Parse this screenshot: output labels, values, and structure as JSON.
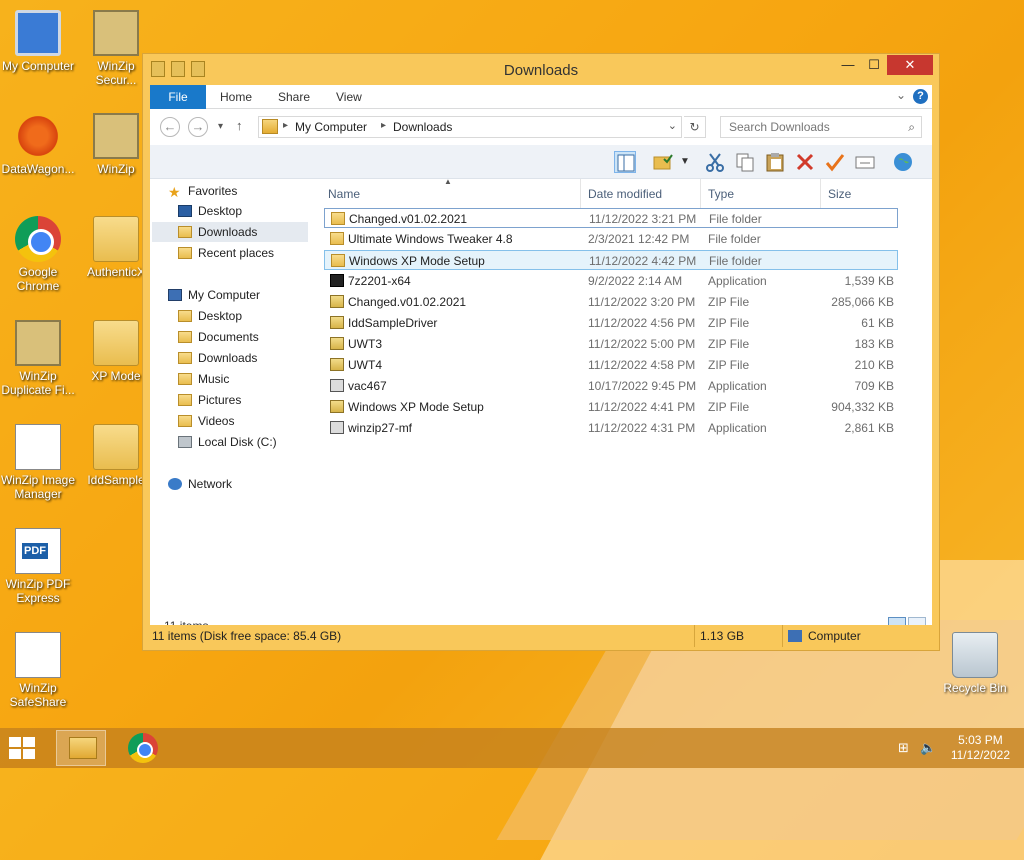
{
  "desktop": {
    "icons": [
      {
        "label": "My Computer"
      },
      {
        "label": "WinZip Secur..."
      },
      {
        "label": "DataWagon..."
      },
      {
        "label": "WinZip"
      },
      {
        "label": "Google Chrome"
      },
      {
        "label": "AuthenticX"
      },
      {
        "label": "WinZip Duplicate Fi..."
      },
      {
        "label": "XP Mode"
      },
      {
        "label": "WinZip Image Manager"
      },
      {
        "label": "IddSample"
      },
      {
        "label": "WinZip PDF Express"
      },
      {
        "label": "WinZip SafeShare"
      },
      {
        "label": "Recycle Bin"
      }
    ]
  },
  "window": {
    "title": "Downloads",
    "close_glyph": "✕",
    "min_glyph": "—",
    "max_glyph": "☐"
  },
  "ribbon": {
    "tabs": [
      "File",
      "Home",
      "Share",
      "View"
    ],
    "help": "?"
  },
  "nav": {
    "back": "←",
    "forward": "→",
    "up": "↑",
    "recent": "▾",
    "breadcrumb": [
      "My Computer",
      "Downloads"
    ],
    "search_placeholder": "Search Downloads"
  },
  "navpane": {
    "favorites": "Favorites",
    "fav_items": [
      "Desktop",
      "Downloads",
      "Recent places"
    ],
    "computer": "My Computer",
    "computer_items": [
      "Desktop",
      "Documents",
      "Downloads",
      "Music",
      "Pictures",
      "Videos",
      "Local Disk (C:)"
    ],
    "network": "Network"
  },
  "columns": [
    "Name",
    "Date modified",
    "Type",
    "Size"
  ],
  "files": [
    {
      "name": "Changed.v01.02.2021",
      "date": "11/12/2022 3:21 PM",
      "type": "File folder",
      "size": "",
      "icon": "folder-icon"
    },
    {
      "name": "Ultimate Windows Tweaker 4.8",
      "date": "2/3/2021 12:42 PM",
      "type": "File folder",
      "size": "",
      "icon": "folder-icon"
    },
    {
      "name": "Windows XP Mode Setup",
      "date": "11/12/2022 4:42 PM",
      "type": "File folder",
      "size": "",
      "icon": "folder-icon"
    },
    {
      "name": "7z2201-x64",
      "date": "9/2/2022 2:14 AM",
      "type": "Application",
      "size": "1,539 KB",
      "icon": "7zip-icon"
    },
    {
      "name": "Changed.v01.02.2021",
      "date": "11/12/2022 3:20 PM",
      "type": "ZIP File",
      "size": "285,066 KB",
      "icon": "zip-icon"
    },
    {
      "name": "IddSampleDriver",
      "date": "11/12/2022 4:56 PM",
      "type": "ZIP File",
      "size": "61 KB",
      "icon": "zip-icon"
    },
    {
      "name": "UWT3",
      "date": "11/12/2022 5:00 PM",
      "type": "ZIP File",
      "size": "183 KB",
      "icon": "zip-icon"
    },
    {
      "name": "UWT4",
      "date": "11/12/2022 4:58 PM",
      "type": "ZIP File",
      "size": "210 KB",
      "icon": "zip-icon"
    },
    {
      "name": "vac467",
      "date": "10/17/2022 9:45 PM",
      "type": "Application",
      "size": "709 KB",
      "icon": "app-icon"
    },
    {
      "name": "Windows XP Mode Setup",
      "date": "11/12/2022 4:41 PM",
      "type": "ZIP File",
      "size": "904,332 KB",
      "icon": "zip-icon"
    },
    {
      "name": "winzip27-mf",
      "date": "11/12/2022 4:31 PM",
      "type": "Application",
      "size": "2,861 KB",
      "icon": "app-icon"
    }
  ],
  "status": {
    "item_count": "11 items",
    "bar_left": "11 items (Disk free space: 85.4 GB)",
    "bar_size": "1.13 GB",
    "bar_location": "Computer"
  },
  "taskbar": {
    "time": "5:03 PM",
    "date": "11/12/2022"
  }
}
